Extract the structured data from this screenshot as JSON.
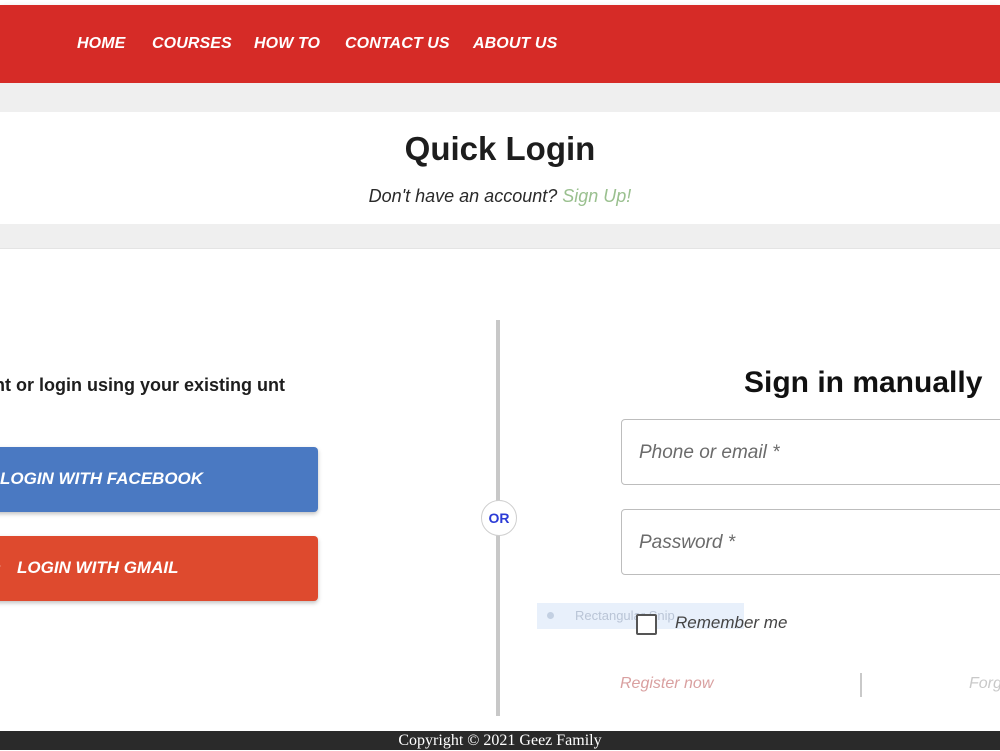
{
  "nav": {
    "items": [
      {
        "label": "HOME"
      },
      {
        "label": "COURSES"
      },
      {
        "label": "HOW TO"
      },
      {
        "label": "CONTACT US"
      },
      {
        "label": "ABOUT US"
      }
    ]
  },
  "header": {
    "title": "Quick Login",
    "signup_prompt": "Don't have an account?",
    "signup_link": "Sign Up!"
  },
  "social": {
    "text": "nt or login using your existing unt",
    "facebook_label": "LOGIN WITH FACEBOOK",
    "gmail_label": "LOGIN WITH GMAIL",
    "gmail_icon": "+",
    "or": "OR"
  },
  "signin": {
    "title": "Sign in manually",
    "phone_placeholder": "Phone or email *",
    "password_placeholder": "Password *",
    "remember_label": "Remember me",
    "register_link": "Register now",
    "forgot_link": "Forg"
  },
  "overlay": {
    "text": "Rectangular Snip"
  },
  "footer": {
    "copyright": "Copyright © 2021 Geez Family"
  },
  "colors": {
    "navbar": "#d62b27",
    "facebook": "#4a79c2",
    "gmail": "#de4a2e",
    "signup_link": "#9ac08f",
    "or_text": "#2b3bd6",
    "footer": "#2a2a2a"
  }
}
